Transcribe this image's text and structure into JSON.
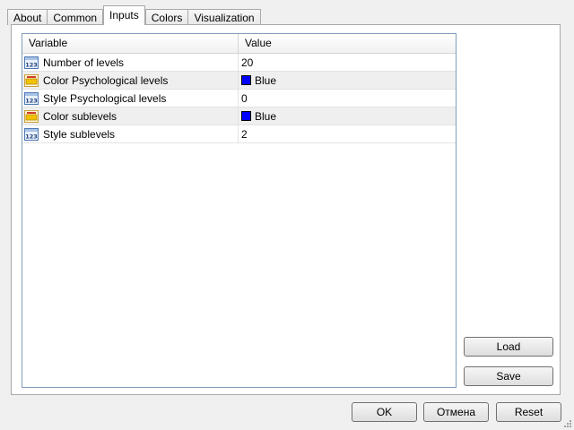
{
  "tabs": [
    {
      "label": "About",
      "active": false
    },
    {
      "label": "Common",
      "active": false
    },
    {
      "label": "Inputs",
      "active": true
    },
    {
      "label": "Colors",
      "active": false
    },
    {
      "label": "Visualization",
      "active": false
    }
  ],
  "grid": {
    "headers": {
      "variable": "Variable",
      "value": "Value"
    },
    "rows": [
      {
        "label": "Number of levels",
        "icon": "numeric-icon",
        "value": "20"
      },
      {
        "label": "Color Psychological levels",
        "icon": "color-param-icon",
        "value": "Blue",
        "swatch": "#0000ff"
      },
      {
        "label": "Style Psychological levels",
        "icon": "numeric-icon",
        "value": "0"
      },
      {
        "label": "Color sublevels",
        "icon": "color-param-icon",
        "value": "Blue",
        "swatch": "#0000ff"
      },
      {
        "label": "Style sublevels",
        "icon": "numeric-icon",
        "value": "2"
      }
    ]
  },
  "side_buttons": {
    "load": "Load",
    "save": "Save"
  },
  "dialog_buttons": {
    "ok": "OK",
    "cancel": "Отмена",
    "reset": "Reset"
  }
}
